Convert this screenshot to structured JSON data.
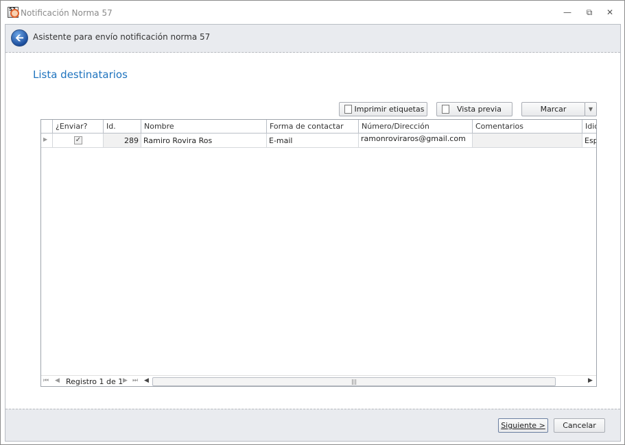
{
  "window": {
    "title": "Notificación Norma 57",
    "app_icon": "57-app-icon",
    "controls": [
      "minimize-icon",
      "restore-icon",
      "close-icon"
    ]
  },
  "header": {
    "title": "Asistente para envío notificación norma 57",
    "back_icon": "back-arrow-icon"
  },
  "section_title": "Lista destinatarios",
  "toolbar": {
    "print_labels": "Imprimir etiquetas",
    "preview": "Vista previa",
    "mark": "Marcar"
  },
  "grid": {
    "columns": [
      "¿Enviar?",
      "Id.",
      "Nombre",
      "Forma de contactar",
      "Número/Dirección",
      "Comentarios",
      "Idio"
    ],
    "rows": [
      {
        "enviar": true,
        "id": "289",
        "nombre": "Ramiro Rovira Ros",
        "forma": "E-mail",
        "direccion": "ramonroviraros@gmail.com",
        "comentarios": "",
        "idioma": "Esp"
      }
    ],
    "navigator": "Registro 1 de 1"
  },
  "footer": {
    "next": "Siguiente >",
    "cancel": "Cancelar"
  },
  "colors": {
    "accent": "#1e73be",
    "band": "#e9ebef"
  }
}
